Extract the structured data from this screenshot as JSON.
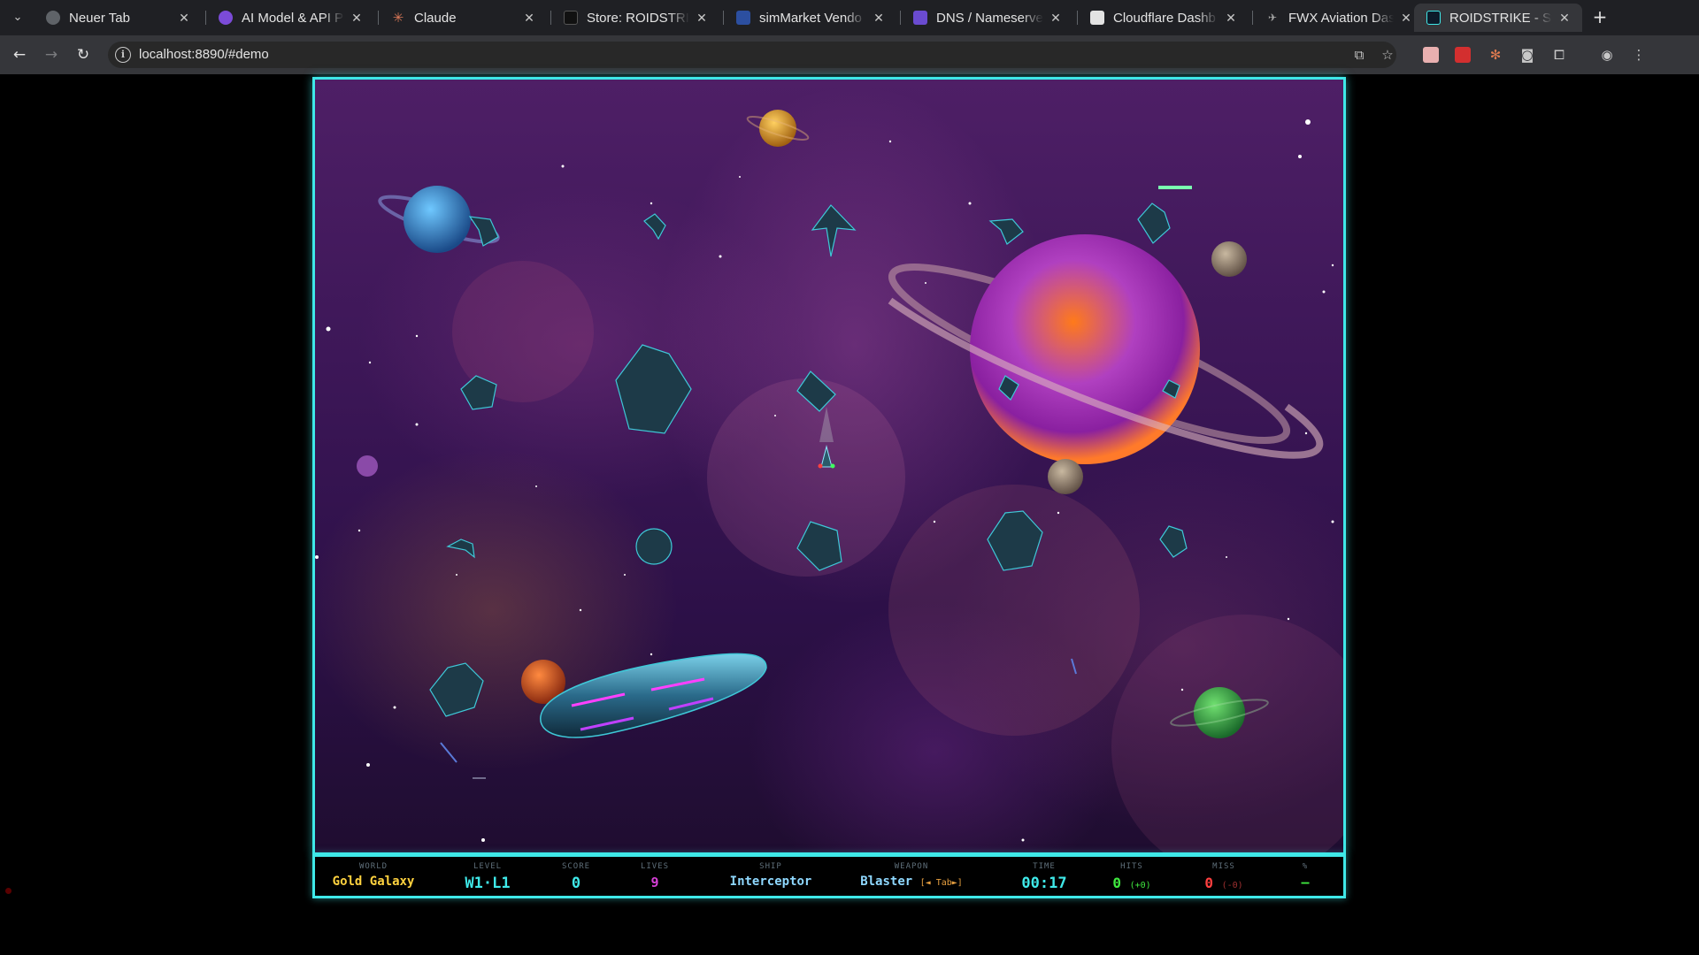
{
  "browser": {
    "tabs": [
      {
        "title": "Neuer Tab",
        "icon": "chrome-icon"
      },
      {
        "title": "AI Model & API Pr",
        "icon": "ai-model-favicon"
      },
      {
        "title": "Claude",
        "icon": "claude-favicon"
      },
      {
        "title": "Store: ROIDSTRIK",
        "icon": "store-favicon"
      },
      {
        "title": "simMarket Vendo",
        "icon": "simmarket-favicon"
      },
      {
        "title": "DNS / Nameserve",
        "icon": "dns-favicon"
      },
      {
        "title": "Cloudflare Dashb",
        "icon": "cloudflare-favicon"
      },
      {
        "title": "FWX Aviation Das",
        "icon": "fwx-favicon"
      },
      {
        "title": "ROIDSTRIKE - Syn",
        "icon": "roidstrike-favicon",
        "active": true
      }
    ],
    "url": "localhost:8890/#demo"
  },
  "hud": {
    "world_label": "WORLD",
    "world_value": "Gold Galaxy",
    "level_label": "LEVEL",
    "level_value": "W1·L1",
    "score_label": "SCORE",
    "score_value": "0",
    "lives_label": "LIVES",
    "lives_value": "9",
    "ship_label": "SHIP",
    "ship_value": "Interceptor",
    "weapon_label": "WEAPON",
    "weapon_value": "Blaster",
    "weapon_hint": "[◄ Tab►]",
    "time_label": "TIME",
    "time_value": "00:17",
    "hits_label": "HITS",
    "hits_value": "0",
    "hits_delta": "(+0)",
    "miss_label": "MISS",
    "miss_value": "0",
    "miss_delta": "(-0)",
    "pct_label": "%",
    "pct_value": "—"
  },
  "colors": {
    "hud_border": "#3fe8e8",
    "world": "#ffd23f",
    "level": "#3fe8e8",
    "score": "#3fe8e8",
    "lives": "#d63fd6",
    "ship": "#8fd8ff",
    "weapon": "#8fd8ff",
    "time": "#3fe8e8",
    "hits": "#3fe83f",
    "miss": "#ff3f3f",
    "pct": "#3fe83f"
  }
}
